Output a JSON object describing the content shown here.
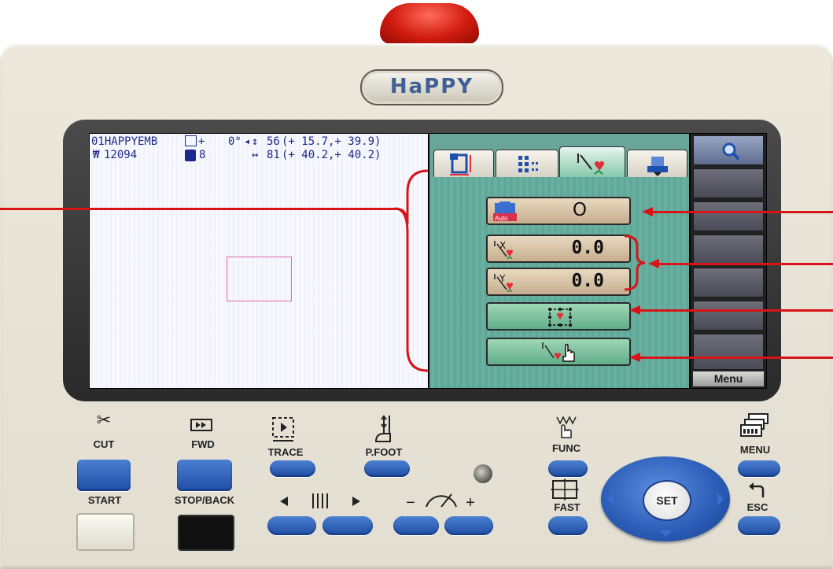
{
  "brand": {
    "logo_text": "HaPPY"
  },
  "screen": {
    "info": {
      "design_name": "01HAPPYEMB",
      "stitches": "12094",
      "start_mark": "+",
      "angle": "0°",
      "colors": "8",
      "height": "56",
      "height_range": "(+ 15.7,+ 39.9)",
      "width": "81",
      "width_range": "(+ 40.2,+ 40.2)"
    },
    "tabs": [
      {
        "icon": "frame-size-icon"
      },
      {
        "icon": "grid-icon"
      },
      {
        "icon": "needle-offset-icon",
        "active": true
      },
      {
        "icon": "frame-down-icon"
      }
    ],
    "offset_panel": {
      "auto_origin": {
        "icon": "auto-origin-icon",
        "value": "O"
      },
      "offset_x": {
        "icon": "offset-x-icon",
        "value": "0.0"
      },
      "offset_y": {
        "icon": "offset-y-icon",
        "value": "0.0"
      },
      "grid_point": {
        "icon": "grid-point-icon"
      },
      "manual_offset": {
        "icon": "manual-offset-icon"
      }
    },
    "sidebar": {
      "search_icon": "search-icon",
      "menu_label": "Menu"
    }
  },
  "keys": {
    "cut": "CUT",
    "fwd": "FWD",
    "trace": "TRACE",
    "pfoot": "P.FOOT",
    "func": "FUNC",
    "menu": "MENU",
    "start": "START",
    "stop_back": "STOP/BACK",
    "fast": "FAST",
    "esc": "ESC",
    "set": "SET",
    "speed_minus": "−",
    "speed_plus": "+"
  },
  "colors": {
    "accent_blue": "#2a5bb5",
    "screen_teal": "#5fa596",
    "annotation_red": "#d81418"
  }
}
